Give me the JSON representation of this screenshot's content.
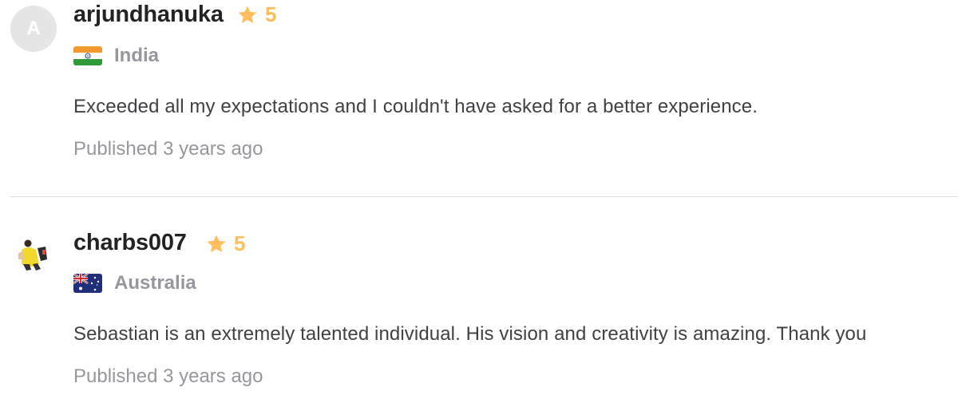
{
  "reviews": [
    {
      "avatar_initial": "A",
      "username": "arjundhanuka",
      "rating": "5",
      "country": "India",
      "flag_icon": "india-flag-icon",
      "text": "Exceeded all my expectations and I couldn't have asked for a better experience.",
      "published": "Published 3 years ago"
    },
    {
      "avatar_initial": "",
      "username": "charbs007",
      "rating": "5",
      "country": "Australia",
      "flag_icon": "australia-flag-icon",
      "text": "Sebastian is an extremely talented individual. His vision and creativity is amazing. Thank you",
      "published": "Published 3 years ago"
    }
  ],
  "colors": {
    "star": "#ffbe5b",
    "username": "#222325",
    "muted": "#95979d",
    "body_text": "#404145",
    "divider": "#dadbdd",
    "avatar_placeholder": "#e5e5e5"
  }
}
